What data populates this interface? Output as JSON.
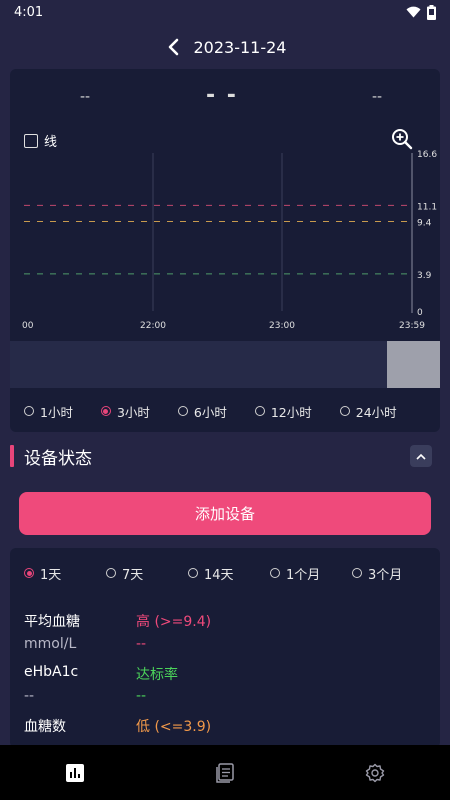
{
  "status_bar": {
    "time": "4:01"
  },
  "header": {
    "date": "2023-11-24"
  },
  "readouts": {
    "left": "--",
    "center": "- -",
    "right": "--"
  },
  "chart_controls": {
    "line_label": "线"
  },
  "chart_data": {
    "type": "line",
    "title": "",
    "xlabel": "",
    "ylabel": "",
    "x_ticks": [
      "00",
      "22:00",
      "23:00",
      "23:59"
    ],
    "y_ticks": [
      "0",
      "3.9",
      "9.4",
      "11.1",
      "16.6"
    ],
    "ylim": [
      0,
      16.6
    ],
    "reference_lines": [
      {
        "value": 11.1,
        "color": "#c0476d"
      },
      {
        "value": 9.4,
        "color": "#c89a4e"
      },
      {
        "value": 3.9,
        "color": "#4f9a6a"
      }
    ],
    "series": []
  },
  "time_ranges": {
    "options": [
      "1小时",
      "3小时",
      "6小时",
      "12小时",
      "24小时"
    ],
    "selected": "3小时"
  },
  "device_status": {
    "title": "设备状态",
    "add_button": "添加设备"
  },
  "periods": {
    "options": [
      "1天",
      "7天",
      "14天",
      "1个月",
      "3个月"
    ],
    "selected": "1天"
  },
  "stats": {
    "avg_label": "平均血糖",
    "avg_unit": "mmol/L",
    "high_label": "高 (>=9.4)",
    "high_value": "--",
    "ehba1c_label": "eHbA1c",
    "ehba1c_value": "--",
    "target_label": "达标率",
    "target_value": "--",
    "count_label": "血糖数",
    "low_label": "低 (<=3.9)"
  },
  "colors": {
    "accent": "#ef4a7b",
    "background": "#252544",
    "card": "#181c36"
  }
}
